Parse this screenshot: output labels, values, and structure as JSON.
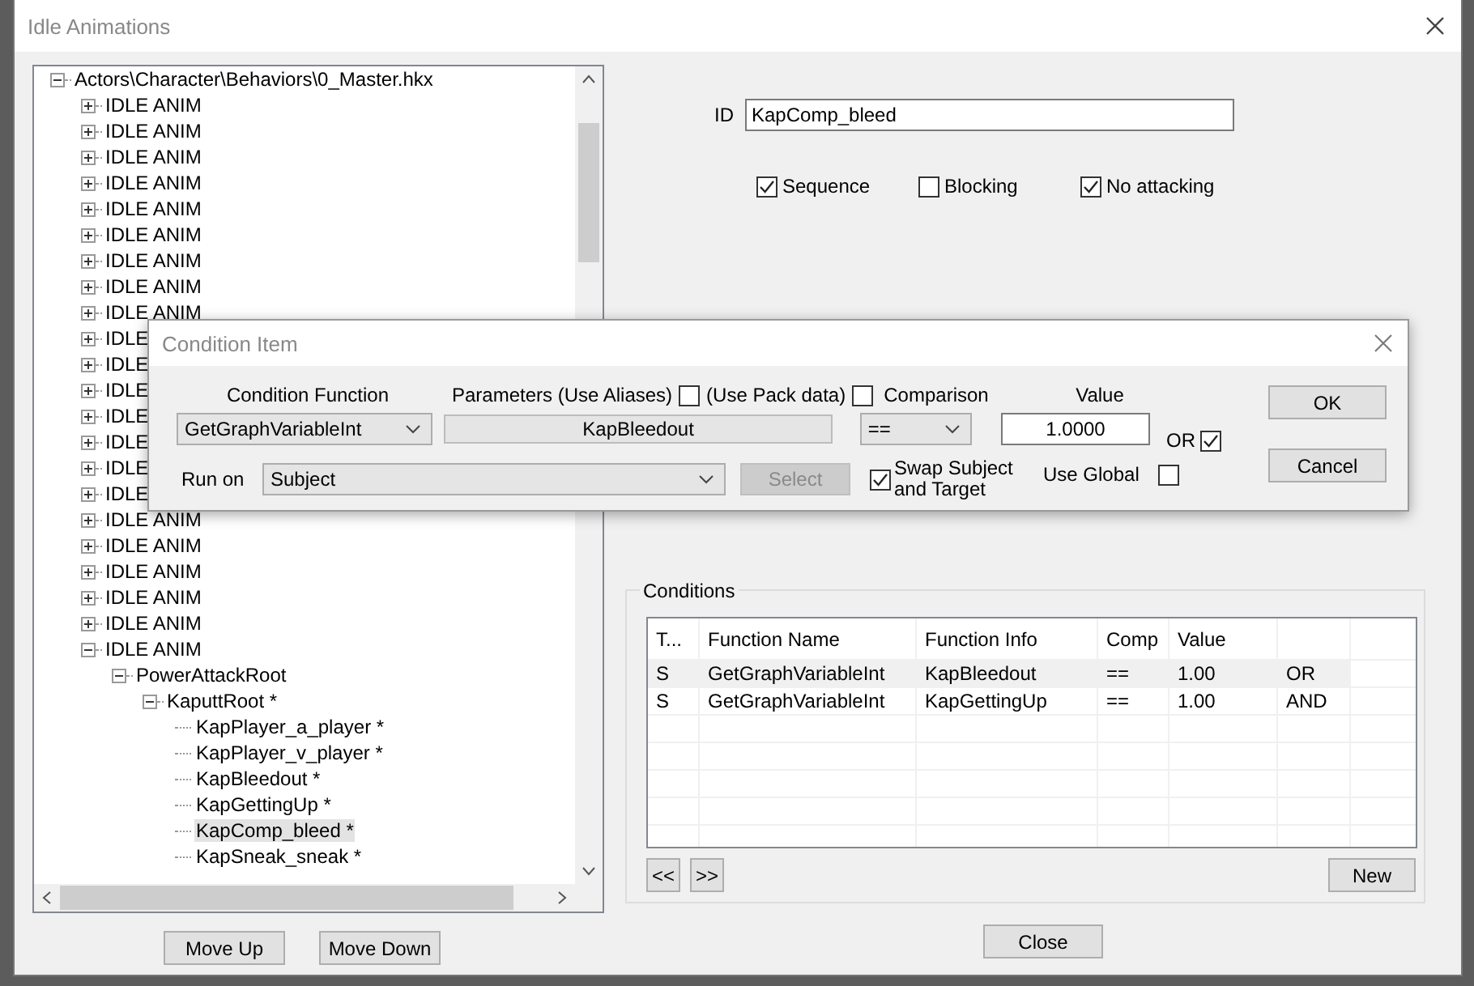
{
  "window": {
    "title": "Idle Animations"
  },
  "tree": {
    "label": "Actors\\Character\\Behaviors\\0_Master.hkx",
    "expanded": true,
    "selected": false,
    "children": [
      {
        "label": "IDLE ANIM",
        "expanded": false,
        "selected": false
      },
      {
        "label": "IDLE ANIM",
        "expanded": false,
        "selected": false
      },
      {
        "label": "IDLE ANIM",
        "expanded": false,
        "selected": false
      },
      {
        "label": "IDLE ANIM",
        "expanded": false,
        "selected": false
      },
      {
        "label": "IDLE ANIM",
        "expanded": false,
        "selected": false
      },
      {
        "label": "IDLE ANIM",
        "expanded": false,
        "selected": false
      },
      {
        "label": "IDLE ANIM",
        "expanded": false,
        "selected": false
      },
      {
        "label": "IDLE ANIM",
        "expanded": false,
        "selected": false
      },
      {
        "label": "IDLE ANIM",
        "expanded": false,
        "selected": false
      },
      {
        "label": "IDLE",
        "expanded": false,
        "selected": false
      },
      {
        "label": "IDLE",
        "expanded": false,
        "selected": false
      },
      {
        "label": "IDLE",
        "expanded": false,
        "selected": false
      },
      {
        "label": "IDLE",
        "expanded": false,
        "selected": false
      },
      {
        "label": "IDLE",
        "expanded": false,
        "selected": false
      },
      {
        "label": "IDLE",
        "expanded": false,
        "selected": false
      },
      {
        "label": "IDLE",
        "expanded": false,
        "selected": false
      },
      {
        "label": "IDLE ANIM",
        "expanded": false,
        "selected": false
      },
      {
        "label": "IDLE ANIM",
        "expanded": false,
        "selected": false
      },
      {
        "label": "IDLE ANIM",
        "expanded": false,
        "selected": false
      },
      {
        "label": "IDLE ANIM",
        "expanded": false,
        "selected": false
      },
      {
        "label": "IDLE ANIM",
        "expanded": false,
        "selected": false
      },
      {
        "label": "IDLE ANIM",
        "expanded": true,
        "selected": false,
        "children": [
          {
            "label": "PowerAttackRoot",
            "expanded": true,
            "selected": false,
            "children": [
              {
                "label": "KaputtRoot *",
                "expanded": true,
                "selected": false,
                "children": [
                  {
                    "label": "KapPlayer_a_player *",
                    "selected": false
                  },
                  {
                    "label": "KapPlayer_v_player *",
                    "selected": false
                  },
                  {
                    "label": "KapBleedout *",
                    "selected": false
                  },
                  {
                    "label": "KapGettingUp *",
                    "selected": false
                  },
                  {
                    "label": "KapComp_bleed *",
                    "selected": true
                  },
                  {
                    "label": "KapSneak_sneak *",
                    "selected": false
                  }
                ]
              }
            ]
          }
        ]
      }
    ]
  },
  "tree_buttons": [
    "Move Up",
    "Move Down"
  ],
  "form": {
    "id_label": "ID",
    "id_value": "KapComp_bleed",
    "options": [
      {
        "label": "Sequence",
        "checked": true
      },
      {
        "label": "Blocking",
        "checked": false
      },
      {
        "label": "No attacking",
        "checked": true
      }
    ]
  },
  "conditions": {
    "title": "Conditions",
    "columns": [
      "T...",
      "Function Name",
      "Function Info",
      "Comp",
      "Value"
    ],
    "rows": [
      {
        "cells": [
          "S",
          "GetGraphVariableInt",
          "KapBleedout",
          "==",
          "1.00",
          "OR"
        ],
        "selected": true
      },
      {
        "cells": [
          "S",
          "GetGraphVariableInt",
          "KapGettingUp",
          "==",
          "1.00",
          "AND"
        ],
        "selected": false
      }
    ],
    "nav_buttons": [
      "<<",
      ">>"
    ],
    "new_button": "New"
  },
  "close_button": "Close",
  "condition_item": {
    "title": "Condition Item",
    "condition_function": {
      "label": "Condition Function",
      "value": "GetGraphVariableInt"
    },
    "parameters": {
      "label": "Parameters  (Use Aliases)",
      "use_aliases": false,
      "pack_label": "(Use Pack data)",
      "use_pack_data": false,
      "value": "KapBleedout"
    },
    "comparison": {
      "label": "Comparison",
      "value": "=="
    },
    "value": {
      "label": "Value",
      "value": "1.0000"
    },
    "or": {
      "label": "OR",
      "checked": true
    },
    "run_on": {
      "label": "Run on",
      "value": "Subject"
    },
    "select_button": {
      "label": "Select",
      "disabled": true
    },
    "swap": {
      "label": "Swap Subject and Target",
      "checked": true
    },
    "use_global": {
      "label": "Use Global",
      "checked": false
    },
    "buttons": [
      "OK",
      "Cancel"
    ]
  }
}
